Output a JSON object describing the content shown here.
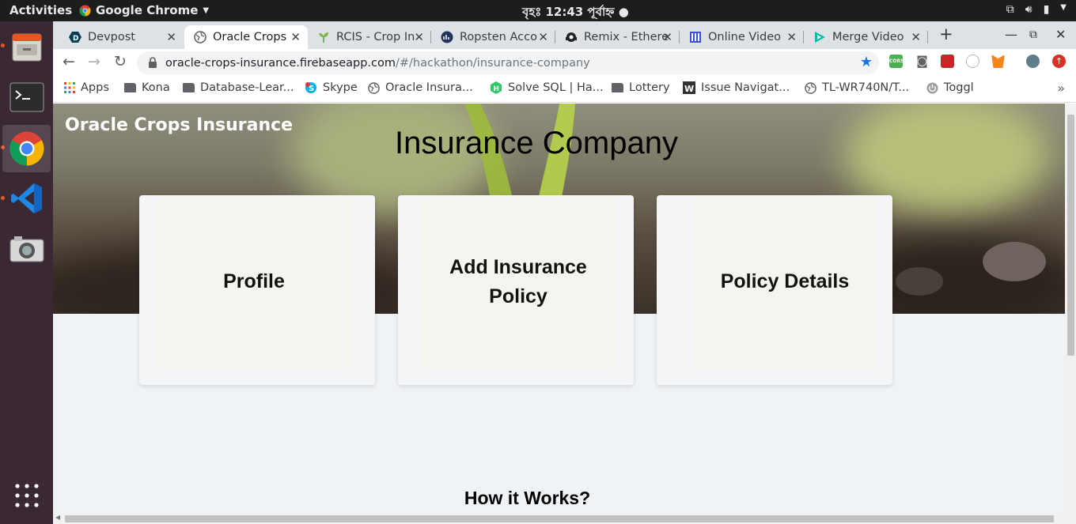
{
  "system": {
    "activities": "Activities",
    "app_menu": "Google Chrome",
    "clock": "বৃহঃ 12:43 পূর্বাহ্ন"
  },
  "tabs": [
    {
      "title": "Devpost",
      "active": false
    },
    {
      "title": "Oracle Crops",
      "active": true
    },
    {
      "title": "RCIS - Crop In",
      "active": false
    },
    {
      "title": "Ropsten Acco",
      "active": false
    },
    {
      "title": "Remix - Ethere",
      "active": false
    },
    {
      "title": "Online Video",
      "active": false
    },
    {
      "title": "Merge Video",
      "active": false
    }
  ],
  "address": {
    "host": "oracle-crops-insurance.firebaseapp.com",
    "path": "/#/hackathon/insurance-company"
  },
  "bookmarks": [
    "Apps",
    "Kona",
    "Database-Lear...",
    "Skype",
    "Oracle Insura...",
    "Solve SQL | Ha...",
    "Lottery",
    "Issue Navigat...",
    "TL-WR740N/T...",
    "Toggl"
  ],
  "page": {
    "brand": "Oracle Crops Insurance",
    "title": "Insurance Company",
    "cards": [
      "Profile",
      "Add Insurance Policy",
      "Policy Details"
    ],
    "how_it_works": "How it Works?"
  },
  "colors": {
    "accent": "#1a73e8",
    "dock_bg": "#3a2935",
    "ubuntu_orange": "#e95420"
  }
}
